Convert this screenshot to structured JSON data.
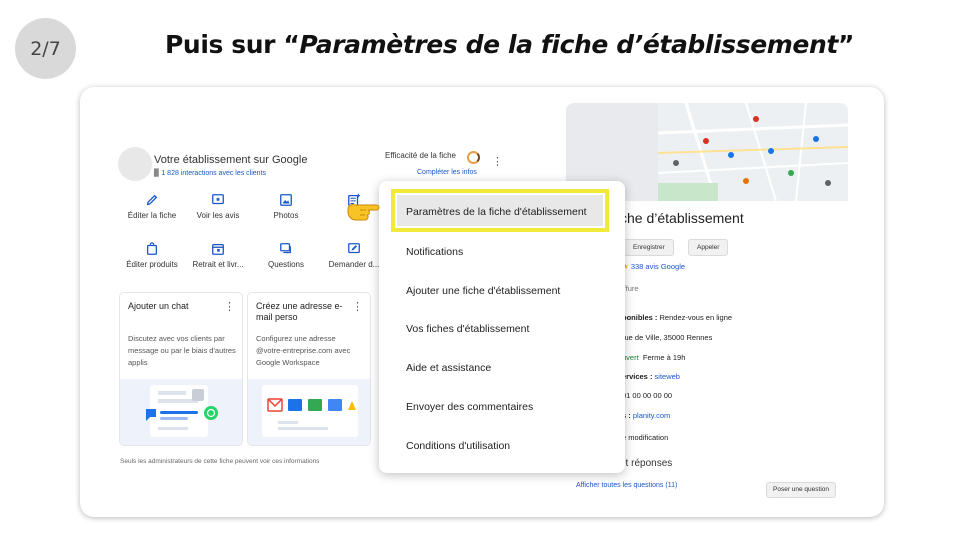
{
  "slide": {
    "step": "2/7",
    "headline_prefix": "Puis sur “",
    "headline_italic": "Paramètres de la fiche d’établissement",
    "headline_suffix": "”"
  },
  "business": {
    "title": "Votre établissement sur Google",
    "interactions": "1 828 interactions avec les clients",
    "efficiency_label": "Efficacité de la fiche",
    "complete_link": "Compléter les infos"
  },
  "actions_row1": [
    {
      "label": "Éditer la fiche",
      "icon": "pencil-icon"
    },
    {
      "label": "Voir les avis",
      "icon": "review-icon"
    },
    {
      "label": "Photos",
      "icon": "image-icon"
    },
    {
      "label": "P",
      "icon": "post-icon"
    }
  ],
  "actions_row2": [
    {
      "label": "Éditer produits",
      "icon": "shopping-bag-icon"
    },
    {
      "label": "Retrait et livr...",
      "icon": "calendar-icon"
    },
    {
      "label": "Questions",
      "icon": "chat-icon"
    },
    {
      "label": "Demander d...",
      "icon": "review-request-icon"
    }
  ],
  "cards": [
    {
      "title": "Ajouter un chat",
      "desc": "Discutez avec vos clients par message ou par le biais d'autres applis"
    },
    {
      "title": "Créez une adresse e-mail perso",
      "desc": "Configurez une adresse @votre-entreprise.com avec Google Workspace"
    }
  ],
  "admin_note": "Seuls les administrateurs de cette fiche peuvent voir ces informations",
  "menu": {
    "highlighted": "Paramètres de la fiche d'établissement",
    "items": [
      "Notifications",
      "Ajouter une fiche d'établissement",
      "Vos fiches d'établissement",
      "Aide et assistance",
      "Envoyer des commentaires",
      "Conditions d'utilisation"
    ]
  },
  "preview": {
    "title_fragment": "che d’établissement",
    "save_button": "Enregistrer",
    "call_button": "Appeler",
    "reviews": "338 avis Google",
    "star": "★",
    "category_fragment": "iffure",
    "availability_label": "ponibles :",
    "availability_value": "Rendez-vous en ligne",
    "address_fragment": "rue de Ville, 35000 Rennes",
    "open_fragment": "uvert",
    "closes": "Ferme à 19h",
    "services_label": "ervices :",
    "services_value": "siteweb",
    "phone_fragment": "01 00 00 00 00",
    "booking_label": "s :",
    "booking_value": "planity.com",
    "suggest_fragment": "e modification",
    "qa_fragment": "et réponses",
    "all_questions": "Afficher toutes les questions (11)",
    "ask_button": "Poser une question"
  },
  "colors": {
    "highlight_border": "#f2ea3a",
    "link_blue": "#1a57c9",
    "open_green": "#188038",
    "star": "#f4b400"
  }
}
